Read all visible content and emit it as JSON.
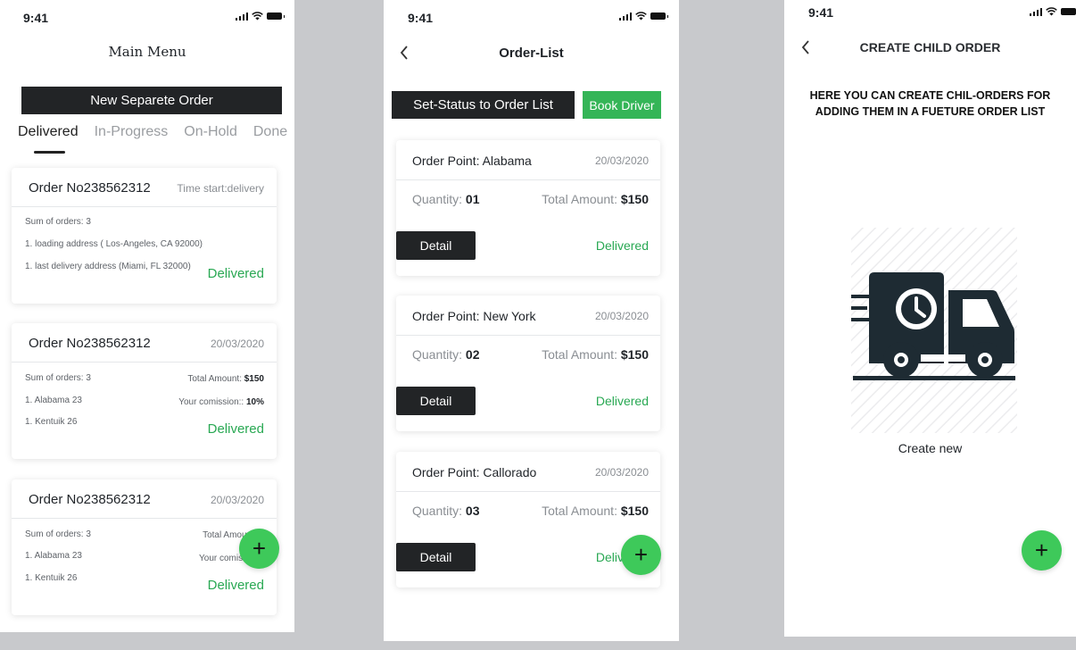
{
  "status": {
    "time": "9:41"
  },
  "main_menu": {
    "title": "Main Menu",
    "new_order_button": "New Separete Order",
    "tabs": [
      {
        "label": "Delivered",
        "active": true
      },
      {
        "label": "In-Progress",
        "active": false
      },
      {
        "label": "On-Hold",
        "active": false
      },
      {
        "label": "Done",
        "active": false
      }
    ],
    "cards": [
      {
        "order_no": "Order No238562312",
        "right": "Time start:delivery",
        "lines": [
          "Sum of orders: 3",
          "1. loading address ( Los-Angeles, CA 92000)",
          "1. last delivery address (Miami, FL 32000)"
        ],
        "status": "Delivered"
      },
      {
        "order_no": "Order No238562312",
        "right": "20/03/2020",
        "lines": [
          "Sum of orders: 3",
          "1. Alabama 23",
          "1. Kentuik 26"
        ],
        "total_label": "Total Amount:",
        "total_value": "$150",
        "commission_label": "Your comission::",
        "commission_value": "10%",
        "status": "Delivered"
      },
      {
        "order_no": "Order No238562312",
        "right": "20/03/2020",
        "lines": [
          "Sum of orders: 3",
          "1. Alabama 23",
          "1. Kentuik 26"
        ],
        "total_label": "Total Amount:",
        "total_value": "$",
        "commission_label": "Your comission::",
        "commission_value": "",
        "status": "Delivered"
      }
    ],
    "fab": "+"
  },
  "order_list": {
    "title": "Order-List",
    "set_status_button": "Set-Status to Order List",
    "book_driver_button": "Book Driver",
    "orders": [
      {
        "point": "Order Point: Alabama",
        "date": "20/03/2020",
        "qty_label": "Quantity:",
        "qty": "01",
        "amount_label": "Total Amount:",
        "amount": "$150",
        "detail": "Detail",
        "status": "Delivered"
      },
      {
        "point": "Order Point: New York",
        "date": "20/03/2020",
        "qty_label": "Quantity:",
        "qty": "02",
        "amount_label": "Total Amount:",
        "amount": "$150",
        "detail": "Detail",
        "status": "Delivered"
      },
      {
        "point": "Order Point: Callorado",
        "date": "20/03/2020",
        "qty_label": "Quantity:",
        "qty": "03",
        "amount_label": "Total Amount:",
        "amount": "$150",
        "detail": "Detail",
        "status": "Delivered"
      }
    ],
    "fab": "+"
  },
  "child_order": {
    "title": "CREATE CHILD ORDER",
    "description_line1": "HERE YOU CAN CREATE CHIL-ORDERS FOR",
    "description_line2": "ADDING THEM IN A FUETURE ORDER LIST",
    "create_label": "Create new",
    "fab": "+"
  },
  "colors": {
    "accent_green": "#3ec95a",
    "delivered_green": "#29a853",
    "dark_button": "#222426",
    "truck": "#1e2b33"
  }
}
